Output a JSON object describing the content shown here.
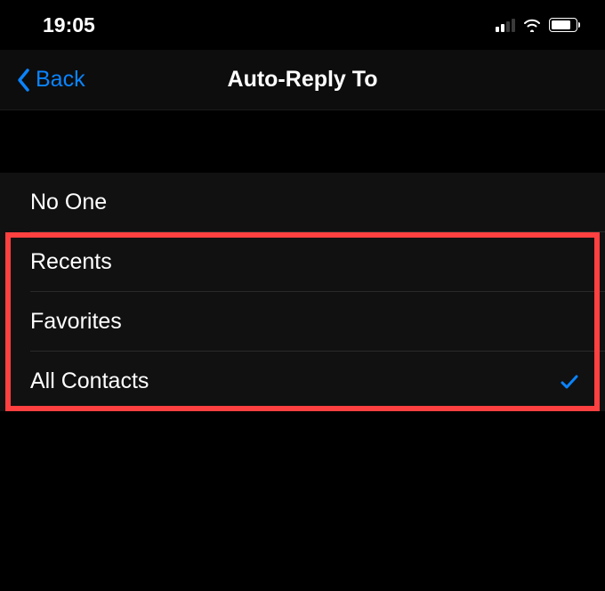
{
  "status": {
    "time": "19:05",
    "signal_bars_active": 2,
    "battery_pct": 80
  },
  "nav": {
    "back_label": "Back",
    "title": "Auto-Reply To"
  },
  "options": [
    {
      "label": "No One",
      "selected": false,
      "highlighted": false
    },
    {
      "label": "Recents",
      "selected": false,
      "highlighted": true
    },
    {
      "label": "Favorites",
      "selected": false,
      "highlighted": true
    },
    {
      "label": "All Contacts",
      "selected": true,
      "highlighted": true
    }
  ],
  "colors": {
    "accent": "#0a84ff",
    "highlight": "#ff4040"
  }
}
